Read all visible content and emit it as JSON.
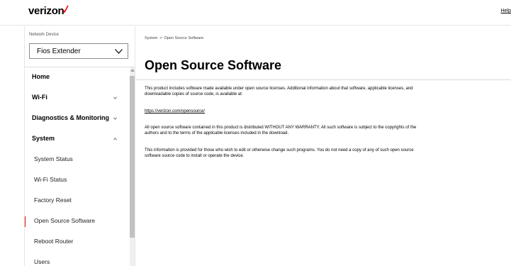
{
  "header": {
    "logo_text": "verizon",
    "help_label": "Help",
    "brand_color": "#ee0000"
  },
  "sidebar": {
    "device_label": "Network Device",
    "device_selected": "Fios Extender",
    "items": [
      {
        "label": "Home",
        "level": "top",
        "chevron": "none"
      },
      {
        "label": "Wi-Fi",
        "level": "top",
        "chevron": "chevron-down-icon"
      },
      {
        "label": "Diagnostics & Monitoring",
        "level": "top",
        "chevron": "chevron-down-icon"
      },
      {
        "label": "System",
        "level": "top",
        "chevron": "chevron-up-icon"
      },
      {
        "label": "System Status",
        "level": "sub"
      },
      {
        "label": "Wi-Fi Status",
        "level": "sub"
      },
      {
        "label": "Factory Reset",
        "level": "sub"
      },
      {
        "label": "Open Source Software",
        "level": "sub",
        "active": true
      },
      {
        "label": "Reboot Router",
        "level": "sub"
      },
      {
        "label": "Users",
        "level": "sub"
      }
    ]
  },
  "breadcrumb": {
    "parent": "System",
    "separator": ">",
    "current": "Open Source Software"
  },
  "main": {
    "title": "Open Source Software",
    "para1": "This product includes software made available under open source licenses. Additional information about that software, applicable licenses, and downloadable copies of source code, is available at:",
    "link": "https://verizon.com/opensource/",
    "para2": "All open source software contained in this product is distributed WITHOUT ANY WARRANTY. All such software is subject to the copyrights of the authors and to the terms of the applicable licenses included in the download.",
    "para3": "This information is provided for those who wish to edit or otherwise change such programs. You do not need a copy of any of such open source software source code to install or operate the device."
  }
}
